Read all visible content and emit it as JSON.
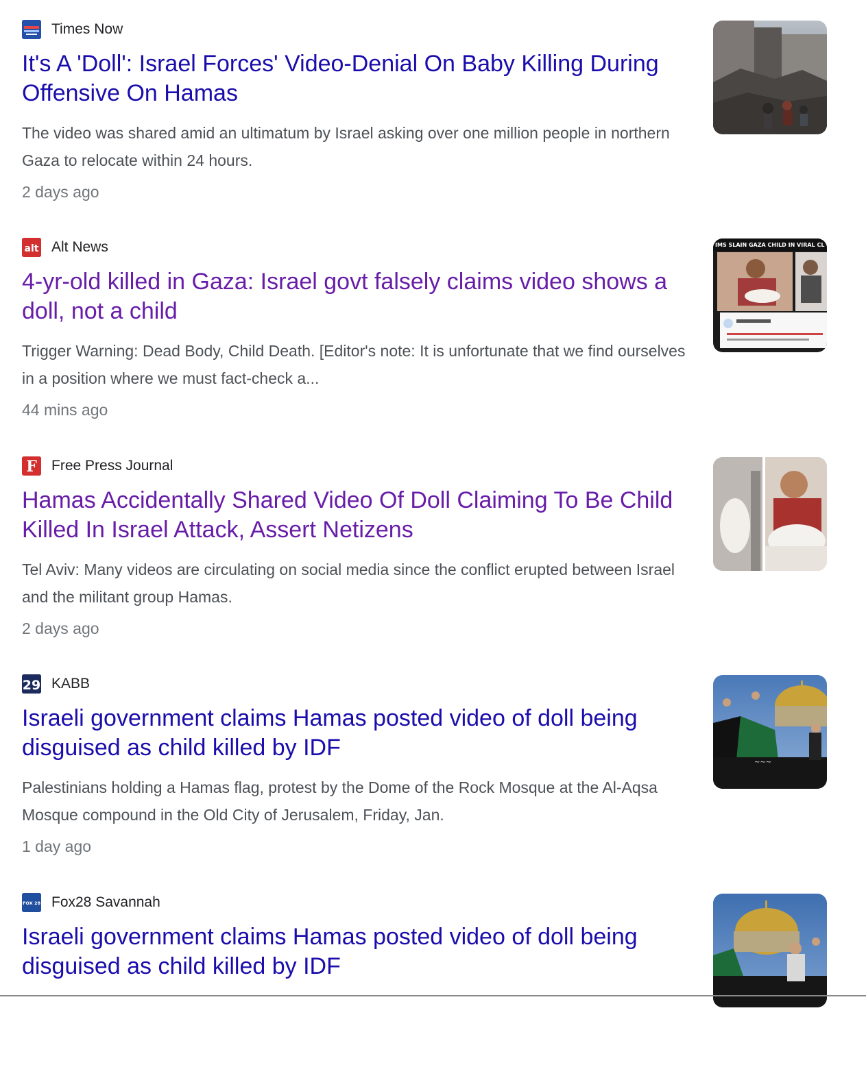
{
  "articles": [
    {
      "source": "Times Now",
      "favicon": "times-now-logo-icon",
      "favicon_color": "#2350a8",
      "headline": "It's A 'Doll': Israel Forces' Video-Denial On Baby Killing During Offensive On Hamas",
      "headline_visited": false,
      "snippet": "The video was shared amid an ultimatum by Israel asking over one million people in northern Gaza to relocate within 24 hours.",
      "time": "2 days ago",
      "thumbnail": "rubble-thumbnail"
    },
    {
      "source": "Alt News",
      "favicon": "alt-news-logo-icon",
      "favicon_color": "#d32f2f",
      "favicon_text": "alt",
      "headline": "4-yr-old killed in Gaza: Israel govt falsely claims video shows a doll, not a child",
      "headline_visited": true,
      "snippet": "Trigger Warning: Dead Body, Child Death. [Editor's note: It is unfortunate that we find ourselves in a position where we must fact-check a...",
      "time": "44 mins ago",
      "thumbnail": "video-collage-thumbnail",
      "thumbnail_caption": "IMS SLAIN GAZA CHILD IN VIRAL CL"
    },
    {
      "source": "Free Press Journal",
      "favicon": "free-press-journal-logo-icon",
      "favicon_color": "#d32f2f",
      "favicon_text": "F",
      "headline": "Hamas Accidentally Shared Video Of Doll Claiming To Be Child Killed In Israel Attack, Assert Netizens",
      "headline_visited": true,
      "snippet": "Tel Aviv: Many videos are circulating on social media since the conflict erupted between Israel and the militant group Hamas.",
      "time": "2 days ago",
      "thumbnail": "man-holding-child-thumbnail"
    },
    {
      "source": "KABB",
      "favicon": "kabb-29-logo-icon",
      "favicon_color": "#1c2a5e",
      "favicon_text": "29",
      "headline": "Israeli government claims Hamas posted video of doll being disguised as child killed by IDF",
      "headline_visited": false,
      "snippet": "Palestinians holding a Hamas flag, protest by the Dome of the Rock Mosque at the Al-Aqsa Mosque compound in the Old City of Jerusalem, Friday, Jan.",
      "time": "1 day ago",
      "thumbnail": "dome-protest-thumbnail"
    },
    {
      "source": "Fox28 Savannah",
      "favicon": "fox28-logo-icon",
      "favicon_color": "#1f4f9e",
      "favicon_text": "FOX 28",
      "headline": "Israeli government claims Hamas posted video of doll being disguised as child killed by IDF",
      "headline_visited": false,
      "snippet": "",
      "time": "",
      "thumbnail": "dome-protest-thumbnail-2"
    }
  ],
  "colors": {
    "link": "#1a0dab",
    "visited_link": "#681da8",
    "snippet": "#4d5156",
    "time": "#70757a"
  }
}
